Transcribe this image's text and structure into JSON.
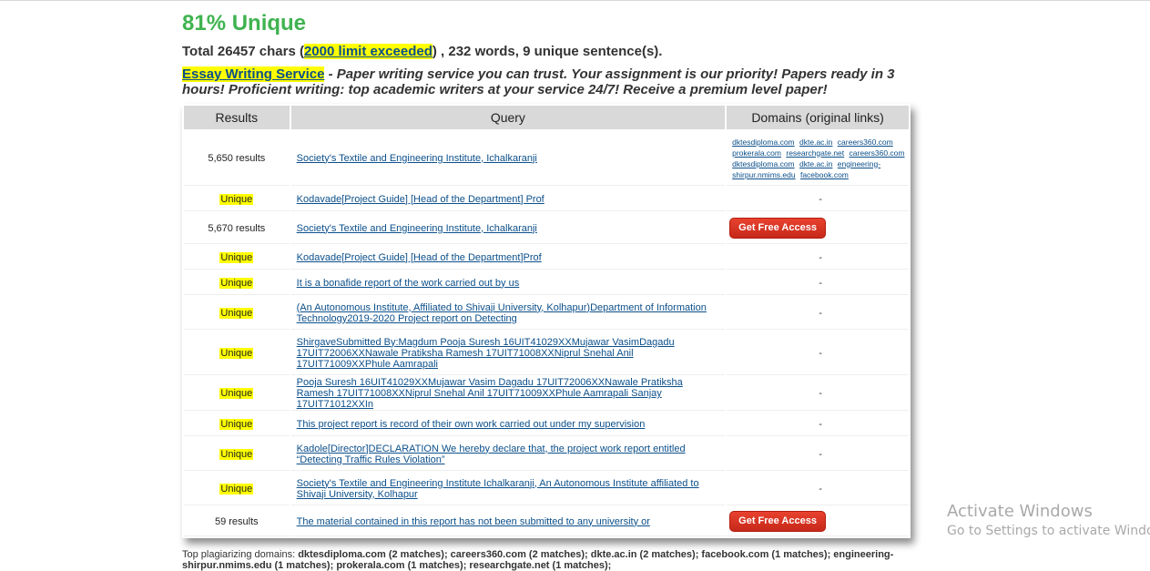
{
  "summary": {
    "unique_pct": "81% Unique",
    "totals_prefix": "Total 26457 chars (",
    "limit_link": "2000 limit exceeded",
    "totals_suffix": ") , 232 words, 9 unique sentence(s)."
  },
  "ad": {
    "link": "Essay Writing Service",
    "text": " - Paper writing service you can trust. Your assignment is our priority! Papers ready in 3 hours! Proficient writing: top academic writers at your service 24/7! Receive a premium level paper!"
  },
  "table": {
    "headers": [
      "Results",
      "Query",
      "Domains (original links)"
    ],
    "rows": [
      {
        "result": "5,650 results",
        "query": "Society's Textile and Engineering Institute, Ichalkaranji",
        "domain_type": "links",
        "domains": [
          "dktesdiploma.com",
          "dkte.ac.in",
          "careers360.com",
          "prokerala.com",
          "researchgate.net",
          "careers360.com",
          "dktesdiploma.com",
          "dkte.ac.in",
          "engineering-shirpur.nmims.edu",
          "facebook.com"
        ]
      },
      {
        "result": "Unique",
        "query": "Kodavade[Project Guide] [Head of the Department] Prof",
        "domain_type": "text",
        "domain": "-"
      },
      {
        "result": "5,670 results",
        "query": "Society's Textile and Engineering Institute, Ichalkaranji",
        "domain_type": "button",
        "domain": "Get Free Access"
      },
      {
        "result": "Unique",
        "query": "Kodavade[Project Guide] [Head of the Department]Prof",
        "domain_type": "text",
        "domain": "-"
      },
      {
        "result": "Unique",
        "query": "It is a bonafide report of the work carried out by us",
        "domain_type": "text",
        "domain": "-"
      },
      {
        "result": "Unique",
        "query": "(An Autonomous Institute, Affiliated to Shivaji University, Kolhapur)Department of Information Technology2019-2020 Project report on Detecting",
        "domain_type": "text",
        "domain": "-"
      },
      {
        "result": "Unique",
        "query": "ShirgaveSubmitted By:Magdum Pooja Suresh 16UIT41029XXMujawar VasimDagadu 17UIT72006XXNawale Pratiksha Ramesh 17UIT71008XXNiprul Snehal Anil 17UIT71009XXPhule Aamrapali",
        "domain_type": "text",
        "domain": "-"
      },
      {
        "result": "Unique",
        "query": "Pooja Suresh 16UIT41029XXMujawar Vasim Dagadu 17UIT72006XXNawale Pratiksha Ramesh 17UIT71008XXNiprul Snehal Anil 17UIT71009XXPhule Aamrapali Sanjay 17UIT71012XXIn",
        "domain_type": "text",
        "domain": "-"
      },
      {
        "result": "Unique",
        "query": "This project report is record of their own work carried out under my supervision",
        "domain_type": "text",
        "domain": "-"
      },
      {
        "result": "Unique",
        "query": "Kadole[Director]DECLARATION We hereby declare that, the project work report entitled “Detecting Traffic Rules Violation”",
        "domain_type": "text",
        "domain": "-"
      },
      {
        "result": "Unique",
        "query": "Society's Textile and Engineering Institute Ichalkaranji, An Autonomous Institute affiliated to Shivaji University, Kolhapur",
        "domain_type": "text",
        "domain": "-"
      },
      {
        "result": "59 results",
        "query": "The material contained in this report has not been submitted to any university or",
        "domain_type": "button",
        "domain": "Get Free Access"
      }
    ]
  },
  "footer": {
    "label": "Top plagiarizing domains: ",
    "domains": "dktesdiploma.com (2 matches); careers360.com (2 matches); dkte.ac.in (2 matches); facebook.com (1 matches); engineering-shirpur.nmims.edu (1 matches); prokerala.com (1 matches); researchgate.net (1 matches);"
  },
  "watermark": {
    "title": "Activate Windows",
    "subtitle": "Go to Settings to activate Windows."
  },
  "colors": {
    "unique_green": "#3fb34f",
    "highlight": "#ffff00",
    "link_blue": "#0b4f8a",
    "button_red": "#d9331f",
    "header_gray": "#d9d9d9"
  }
}
